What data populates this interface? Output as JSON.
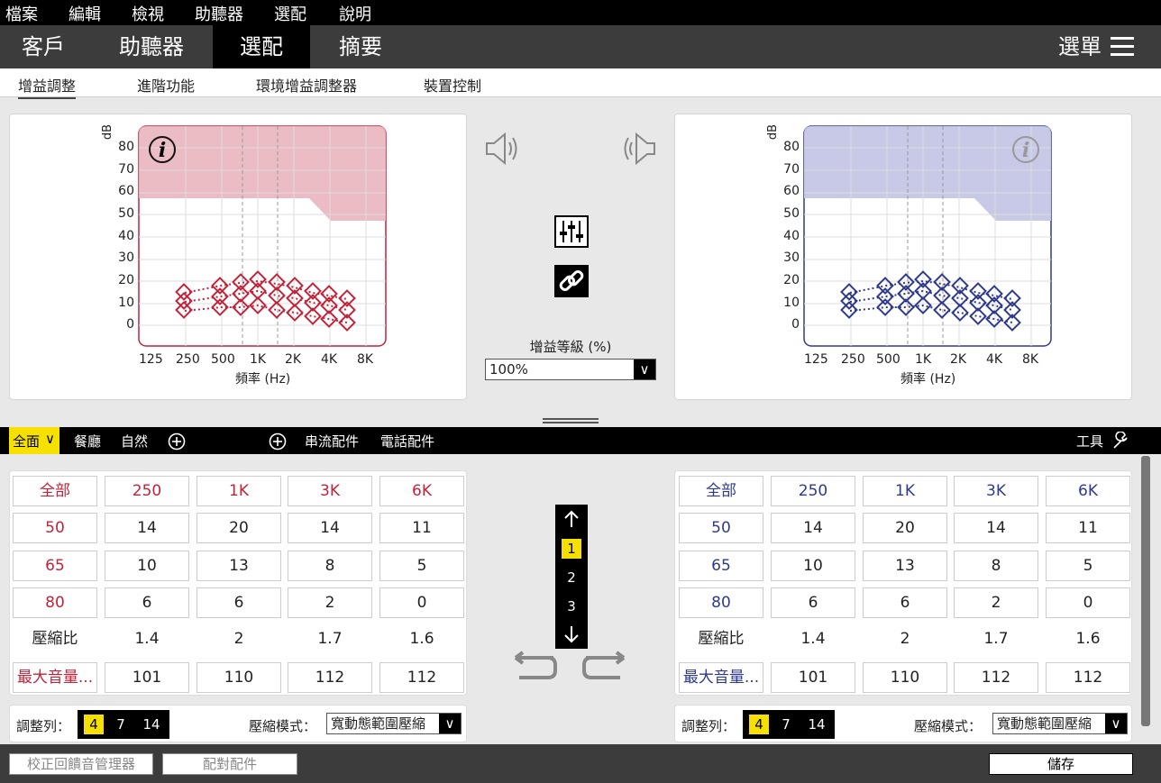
{
  "menu": {
    "items": [
      "檔案",
      "編輯",
      "檢視",
      "助聽器",
      "選配",
      "說明"
    ]
  },
  "tabs": {
    "items": [
      "客戶",
      "助聽器",
      "選配",
      "摘要"
    ],
    "active": 2,
    "menu_label": "選單"
  },
  "subtabs": {
    "items": [
      "增益調整",
      "進階功能",
      "環境增益調整器",
      "裝置控制"
    ],
    "active": 0
  },
  "graph": {
    "ylabel": "dB",
    "yticks": [
      "80",
      "70",
      "60",
      "50",
      "40",
      "30",
      "20",
      "10",
      "0"
    ],
    "xticks": [
      "125",
      "250",
      "500",
      "1K",
      "2K",
      "4K",
      "8K"
    ],
    "xlabel": "頻率 (Hz)",
    "left_color": "#c0243a",
    "right_color": "#2f3a8c"
  },
  "center": {
    "gain_level_label": "增益等級 (%)",
    "gain_level_value": "100%"
  },
  "strip": {
    "program_selected": "全面",
    "programs": [
      "餐廳",
      "自然"
    ],
    "streaming": "串流配件",
    "phone": "電話配件",
    "tools": "工具"
  },
  "table": {
    "headers": [
      "全部",
      "250",
      "1K",
      "3K",
      "6K"
    ],
    "rows": [
      {
        "label": "50",
        "values": [
          "14",
          "20",
          "14",
          "11"
        ]
      },
      {
        "label": "65",
        "values": [
          "10",
          "13",
          "8",
          "5"
        ]
      },
      {
        "label": "80",
        "values": [
          "6",
          "6",
          "2",
          "0"
        ]
      },
      {
        "label": "壓縮比",
        "values": [
          "1.4",
          "2",
          "1.7",
          "1.6"
        ]
      },
      {
        "label": "最大音量...",
        "values": [
          "101",
          "110",
          "112",
          "112"
        ]
      }
    ],
    "adjust_label": "調整列：",
    "adjust_options": [
      "4",
      "7",
      "14"
    ],
    "adjust_selected": 0,
    "compression_label": "壓縮模式：",
    "compression_value": "寬動態範圍壓縮"
  },
  "stepper": {
    "items": [
      "1",
      "2",
      "3"
    ],
    "selected": 0
  },
  "bottom": {
    "feedback": "校正回饋音管理器",
    "pair": "配對配件",
    "save": "儲存"
  }
}
